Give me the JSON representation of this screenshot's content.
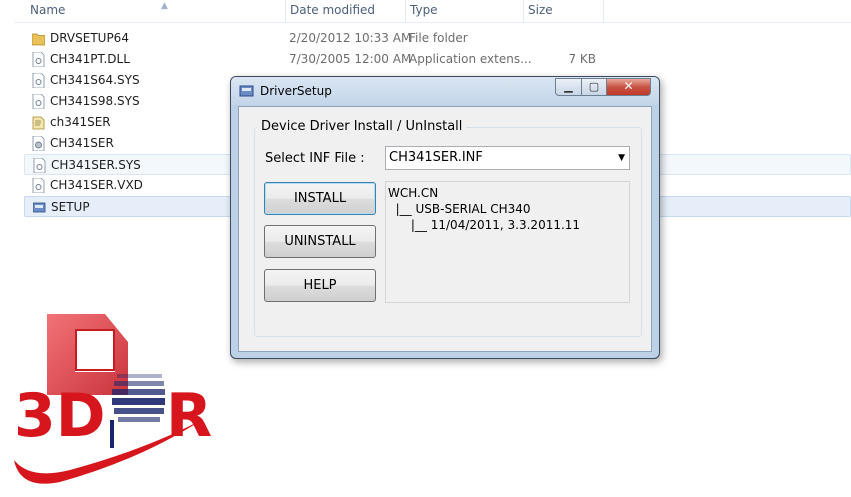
{
  "explorer": {
    "columns": {
      "name": "Name",
      "date": "Date modified",
      "type": "Type",
      "size": "Size"
    },
    "files": [
      {
        "name": "DRVSETUP64",
        "date": "2/20/2012 10:33 AM",
        "type": "File folder",
        "size": "",
        "icon": "folder-icon"
      },
      {
        "name": "CH341PT.DLL",
        "date": "7/30/2005 12:00 AM",
        "type": "Application extens...",
        "size": "7 KB",
        "icon": "dll-file-icon"
      },
      {
        "name": "CH341S64.SYS",
        "date": "",
        "type": "",
        "size": "",
        "icon": "sys-file-icon"
      },
      {
        "name": "CH341S98.SYS",
        "date": "",
        "type": "",
        "size": "",
        "icon": "sys-file-icon"
      },
      {
        "name": "ch341SER",
        "date": "",
        "type": "",
        "size": "",
        "icon": "setup-info-icon"
      },
      {
        "name": "CH341SER",
        "date": "",
        "type": "",
        "size": "",
        "icon": "gear-file-icon"
      },
      {
        "name": "CH341SER.SYS",
        "date": "",
        "type": "",
        "size": "",
        "icon": "sys-file-icon"
      },
      {
        "name": "CH341SER.VXD",
        "date": "",
        "type": "",
        "size": "",
        "icon": "sys-file-icon"
      },
      {
        "name": "SETUP",
        "date": "",
        "type": "",
        "size": "",
        "icon": "setup-app-icon"
      }
    ]
  },
  "logo": {
    "text_left": "3D",
    "text_right": "R",
    "color_red": "#d6151c",
    "color_navy": "#18246b"
  },
  "dialog": {
    "title": "DriverSetup",
    "group_title": "Device Driver Install / UnInstall",
    "inf_label": "Select INF File :",
    "inf_value": "CH341SER.INF",
    "buttons": {
      "install": "INSTALL",
      "uninstall": "UNINSTALL",
      "help": "HELP"
    },
    "info_lines": [
      "WCH.CN",
      "  |__ USB-SERIAL CH340",
      "      |__ 11/04/2011, 3.3.2011.11"
    ]
  }
}
